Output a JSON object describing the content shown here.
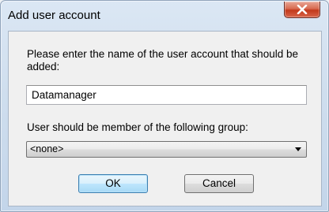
{
  "window": {
    "title": "Add user account",
    "close_icon": "close-icon"
  },
  "form": {
    "prompt_label": "Please enter the name of the user account that should be added:",
    "username_value": "Datamanager",
    "group_label": "User should be member of the following group:",
    "group_selected": "<none>"
  },
  "buttons": {
    "ok_label": "OK",
    "cancel_label": "Cancel"
  },
  "colors": {
    "close_button": "#c7401f",
    "default_button_border": "#3c7fb1"
  }
}
